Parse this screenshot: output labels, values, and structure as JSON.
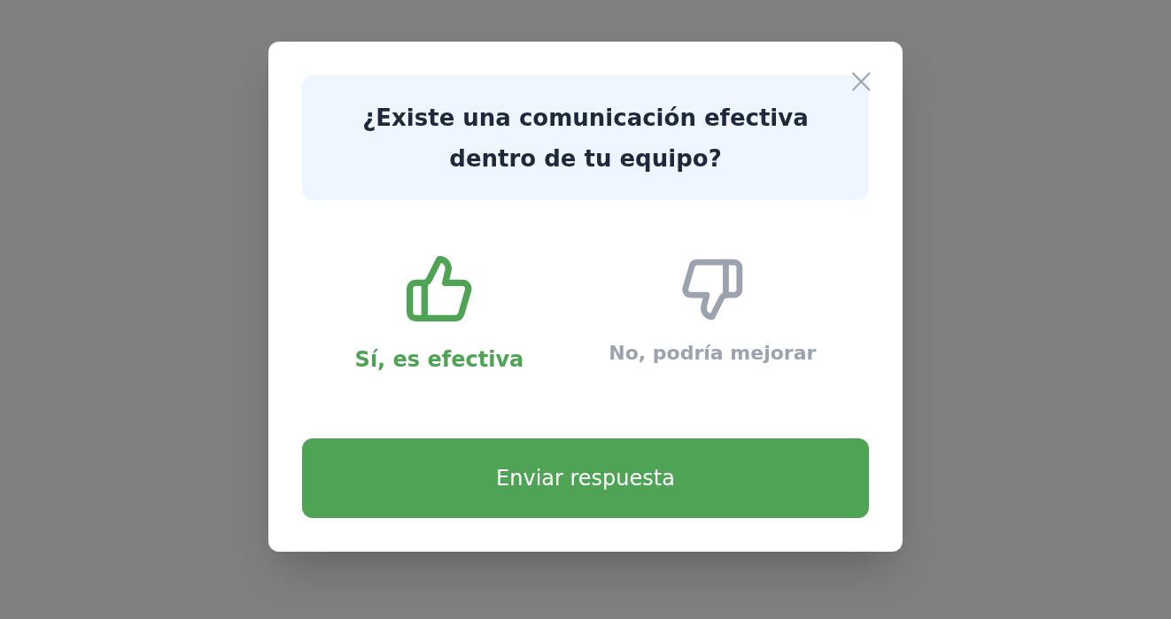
{
  "dialog": {
    "close": "×",
    "question": "¿Existe una comunicación efectiva dentro de tu equipo?",
    "options": [
      {
        "kind": "up",
        "label": "Sí, es efectiva",
        "selected": true
      },
      {
        "kind": "down",
        "label": "No, podría mejorar",
        "selected": false
      }
    ],
    "submit": "Enviar respuesta"
  }
}
